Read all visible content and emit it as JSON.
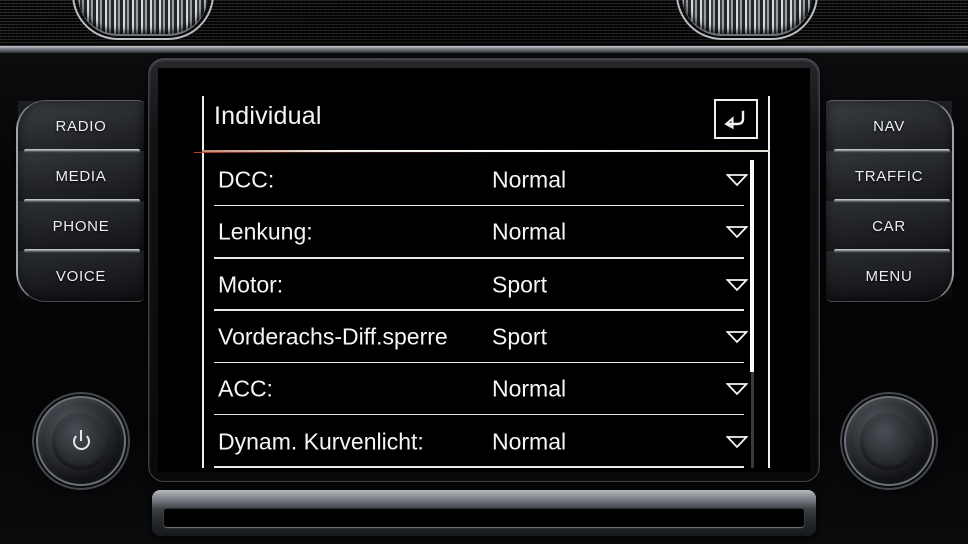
{
  "vehicle_ui": {
    "top_vents": [
      "air-vent-left",
      "air-vent-right"
    ],
    "screen": {
      "header": {
        "title": "Individual",
        "back_button_icon": "back-arrow-icon",
        "accent_rule_color": "#f3ece6"
      },
      "menu_rows": [
        {
          "label": "DCC:",
          "value": "Normal",
          "caret": "chevron-down-icon"
        },
        {
          "label": "Lenkung:",
          "value": "Normal",
          "caret": "chevron-down-icon"
        },
        {
          "label": "Motor:",
          "value": "Sport",
          "caret": "chevron-down-icon"
        },
        {
          "label": "Vorderachs-Diff.sperre",
          "value": "Sport",
          "caret": "chevron-down-icon"
        },
        {
          "label": "ACC:",
          "value": "Normal",
          "caret": "chevron-down-icon"
        },
        {
          "label": "Dynam. Kurvenlicht:",
          "value": "Normal",
          "caret": "chevron-down-icon"
        }
      ],
      "scrollbar": {
        "name": "vertical-scrollbar",
        "thumb_position": "top",
        "thumb_fraction": 0.69
      },
      "background_color": "#000000",
      "text_color": "#f6f6f3"
    },
    "left_buttons": [
      {
        "label": "RADIO"
      },
      {
        "label": "MEDIA"
      },
      {
        "label": "PHONE"
      },
      {
        "label": "VOICE"
      }
    ],
    "right_buttons": [
      {
        "label": "NAV"
      },
      {
        "label": "TRAFFIC"
      },
      {
        "label": "CAR"
      },
      {
        "label": "MENU"
      }
    ],
    "knobs": [
      {
        "name": "power-volume-knob",
        "icon": "power-icon"
      },
      {
        "name": "tune-knob",
        "icon": ""
      }
    ],
    "disc_slot": {
      "name": "cd-slot"
    }
  }
}
